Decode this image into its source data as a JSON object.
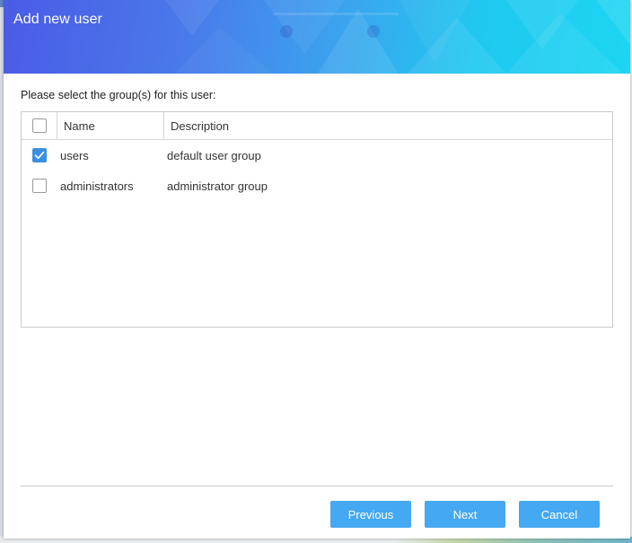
{
  "dialog": {
    "title": "Add new user",
    "instruction": "Please select the group(s) for this user:"
  },
  "grid": {
    "columns": [
      "Name",
      "Description"
    ],
    "select_all_checked": false,
    "rows": [
      {
        "name": "users",
        "description": "default user group",
        "checked": true
      },
      {
        "name": "administrators",
        "description": "administrator group",
        "checked": false
      }
    ]
  },
  "buttons": {
    "previous": "Previous",
    "next": "Next",
    "cancel": "Cancel"
  },
  "colors": {
    "accent": "#44a8f2",
    "checkbox_checked": "#3a8fe0",
    "header_start": "#4a5be6",
    "header_end": "#1cd6f2"
  },
  "icons": {
    "checkmark": "check-icon"
  }
}
